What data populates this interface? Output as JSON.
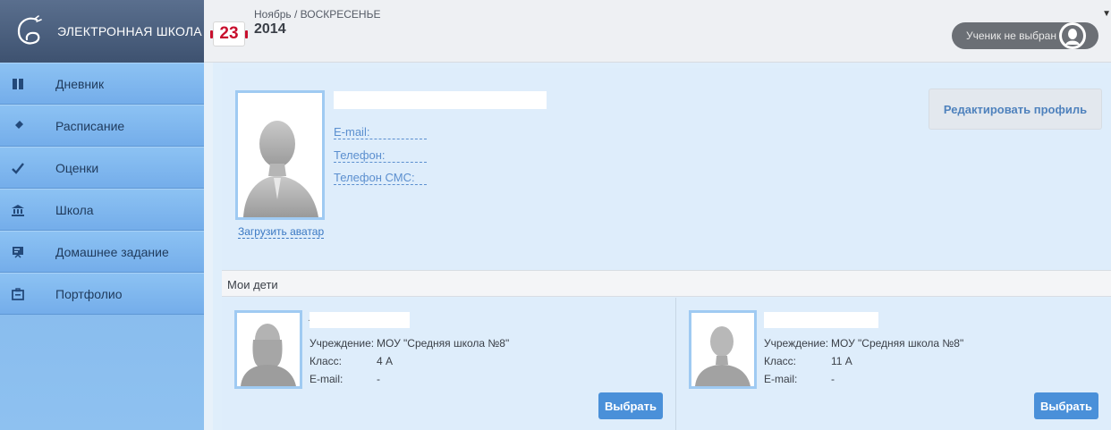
{
  "app": {
    "title": "ЭЛЕКТРОННАЯ ШКОЛА"
  },
  "date": {
    "day": "23",
    "month_weekday": "Ноябрь / ВОСКРЕСЕНЬЕ",
    "year": "2014"
  },
  "student_selector": {
    "label": "Ученик не выбран",
    "icon": "user-avatar-icon"
  },
  "sidebar": {
    "items": [
      {
        "label": "Дневник",
        "icon": "book-icon"
      },
      {
        "label": "Расписание",
        "icon": "pin-icon"
      },
      {
        "label": "Оценки",
        "icon": "checkmark-icon"
      },
      {
        "label": "Школа",
        "icon": "school-building-icon"
      },
      {
        "label": "Домашнее задание",
        "icon": "homework-board-icon"
      },
      {
        "label": "Портфолио",
        "icon": "portfolio-icon"
      }
    ]
  },
  "profile": {
    "email_label": "E-mail:",
    "phone_label": "Телефон:",
    "sms_phone_label": "Телефон СМС:",
    "upload_avatar": "Загрузить аватар",
    "edit_button": "Редактировать профиль"
  },
  "children": {
    "header": "Мои дети",
    "items": [
      {
        "institution_label": "Учреждение:",
        "institution": "МОУ \"Средняя школа №8\"",
        "class_label": "Класс:",
        "class": "4 А",
        "email_label": "E-mail:",
        "email": "-",
        "select_button": "Выбрать"
      },
      {
        "institution_label": "Учреждение:",
        "institution": "МОУ \"Средняя школа №8\"",
        "class_label": "Класс:",
        "class": "11 А",
        "email_label": "E-mail:",
        "email": "-",
        "select_button": "Выбрать"
      }
    ]
  },
  "colors": {
    "header_dark": "#3e5270",
    "sidebar_blue": "#7fb4ea",
    "content_bg": "#deedfb",
    "link_blue": "#5b8fcf",
    "button_blue": "#4a90d9",
    "date_red": "#c8102e"
  }
}
